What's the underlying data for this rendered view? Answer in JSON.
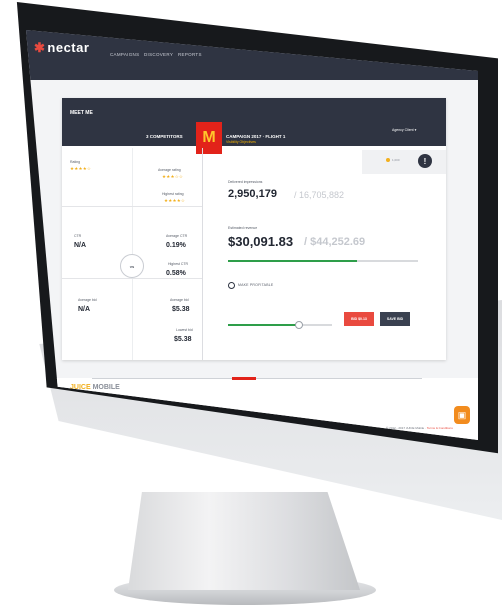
{
  "nav": {
    "logo": "nectar",
    "links": [
      "CAMPAIGNS",
      "DISCOVERY",
      "REPORTS"
    ]
  },
  "card": {
    "meet_me": "MEET ME",
    "competitors": "3 COMPETITORS",
    "brand_mark": "M",
    "campaign_name": "CAMPAIGN 2017 · FLIGHT 1",
    "campaign_sub": "Visibility Objectives",
    "agency": "Agency Client ▾",
    "rating": {
      "label": "Rating",
      "stars": "★★★★☆"
    },
    "avg_rating": {
      "label": "Average rating",
      "stars": "★★★☆☆"
    },
    "highest_rating": {
      "label": "Highest rating",
      "stars": "★★★★☆"
    },
    "ctr": {
      "label": "CTR",
      "value": "N/A"
    },
    "avg_ctr": {
      "label": "Average CTR",
      "value": "0.19%"
    },
    "highest_ctr": {
      "label": "Highest CTR",
      "value": "0.58%"
    },
    "vs": "vs",
    "avg_bid": {
      "label": "Average bid",
      "value": "N/A"
    },
    "avg_bid_comp": {
      "label": "Average bid",
      "value": "$5.38"
    },
    "lowest_bid": {
      "label": "Lowest bid",
      "value": "$5.38"
    },
    "coin_text": "1,000",
    "impressions": {
      "label": "Delivered impressions",
      "value": "2,950,179",
      "total": "/ 16,705,882"
    },
    "spend": {
      "label": "Estimated revenue",
      "value": "$30,091.83",
      "total": "/ $44,252.69",
      "progress": 0.68
    },
    "radio_label": "MAKE PROFITABLE",
    "slider": {
      "value": 0.68
    },
    "btn_red": "BID $0.13",
    "btn_dark": "SAVE BID"
  },
  "footer": {
    "juice_j": "JUICE",
    "juice_rest": " MOBILE",
    "copyright": "© 2012 - 2017 JUICE Mobile · ",
    "copyright_link": "Terms & Conditions"
  },
  "colors": {
    "nav_bg": "#2f3442",
    "accent_red": "#e94a3f",
    "progress_green": "#2e9e4a",
    "star_gold": "#f2b01e"
  },
  "icons": [
    "info-icon",
    "coin-icon",
    "chat-icon",
    "radio-icon"
  ]
}
